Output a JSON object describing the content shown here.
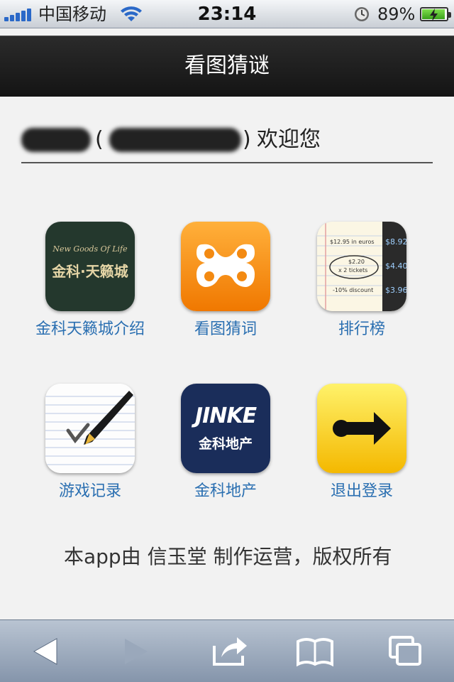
{
  "status_bar": {
    "carrier": "中国移动",
    "time": "23:14",
    "battery_percent": "89%"
  },
  "nav": {
    "title": "看图猜谜"
  },
  "welcome": {
    "suffix": "欢迎您"
  },
  "apps": [
    {
      "label": "金科天籁城介绍",
      "icon_text_top": "New Goods Of Life",
      "icon_text_main": "金科·天籁城",
      "icon": "brochure-icon"
    },
    {
      "label": "看图猜词",
      "icon": "xampp-logo-icon"
    },
    {
      "label": "排行榜",
      "icon": "ledger-icon",
      "icon_text_1": "$12.95 in euros",
      "icon_text_2": "$2.20",
      "icon_text_3": "x 2 tickets",
      "icon_text_4": "-10% discount"
    },
    {
      "label": "游戏记录",
      "icon": "notepad-pen-icon"
    },
    {
      "label": "金科地产",
      "icon_text_main": "JINKE",
      "icon_text_sub": "金科地产",
      "icon": "jinke-logo-icon"
    },
    {
      "label": "退出登录",
      "icon": "exit-arrow-icon"
    }
  ],
  "footer": "本app由 信玉堂 制作运营，版权所有",
  "toolbar": [
    "back-icon",
    "forward-icon",
    "share-icon",
    "bookmarks-icon",
    "tabs-icon"
  ],
  "colors": {
    "link": "#2a6fb1",
    "navbar": "#1c1c1c"
  }
}
